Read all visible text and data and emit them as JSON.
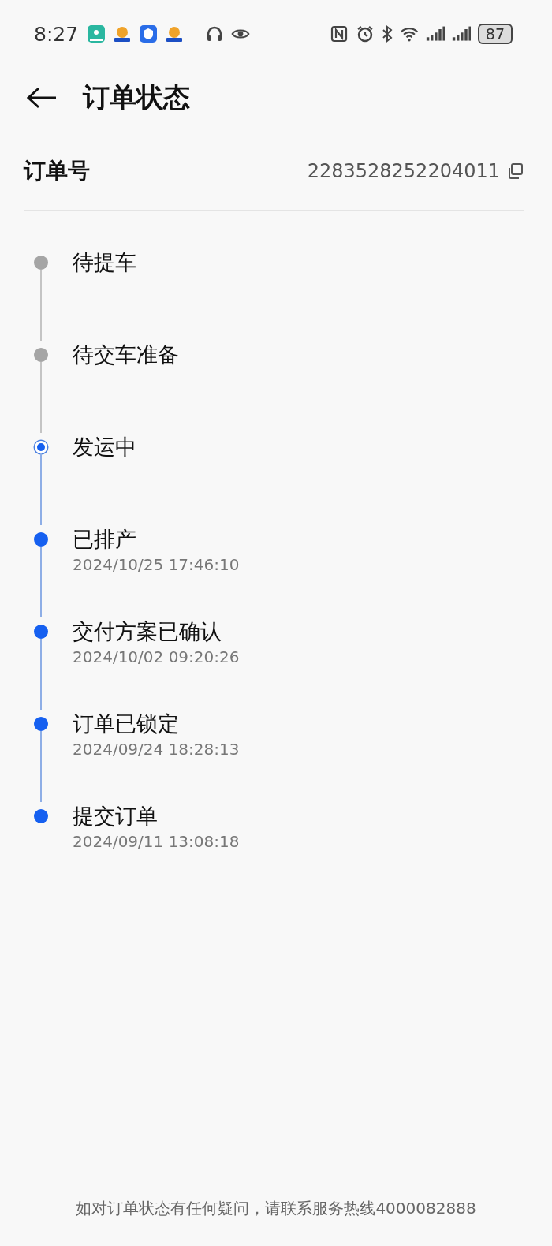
{
  "status_bar": {
    "time": "8:27",
    "battery": "87"
  },
  "header": {
    "title": "订单状态"
  },
  "order": {
    "label": "订单号",
    "number": "2283528252204011"
  },
  "steps": [
    {
      "title": "待提车",
      "reached": false,
      "current": false
    },
    {
      "title": "待交车准备",
      "reached": false,
      "current": false
    },
    {
      "title": "发运中",
      "reached": true,
      "current": true
    },
    {
      "title": "已排产",
      "time": "2024/10/25 17:46:10",
      "reached": true,
      "current": false
    },
    {
      "title": "交付方案已确认",
      "time": "2024/10/02 09:20:26",
      "reached": true,
      "current": false
    },
    {
      "title": "订单已锁定",
      "time": "2024/09/24 18:28:13",
      "reached": true,
      "current": false
    },
    {
      "title": "提交订单",
      "time": "2024/09/11 13:08:18",
      "reached": true,
      "current": false
    }
  ],
  "footer": "如对订单状态有任何疑问，请联系服务热线4000082888"
}
